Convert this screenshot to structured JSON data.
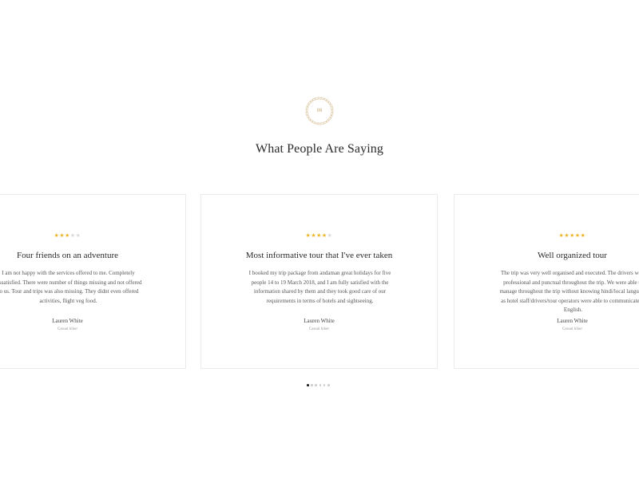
{
  "section": {
    "badge_number": "06",
    "title": "What People Are Saying"
  },
  "colors": {
    "star_filled": "#f0b429",
    "star_empty": "#d9d9d9",
    "badge": "#d8c39a",
    "dot_active": "#222222",
    "dot_inactive": "#cfcfcf"
  },
  "testimonials": [
    {
      "rating": 3,
      "max_rating": 5,
      "title": "Four friends on an adventure",
      "body": "I am not happy with the services offered to me. Completely dissatisfied. There were number of things missing and not offered to us. Tour and trips was also missing. They didnt even offered activities, flight veg food.",
      "author": "Lauren White",
      "role": "Casual hiker"
    },
    {
      "rating": 4,
      "max_rating": 5,
      "title": "Most informative tour that I've ever taken",
      "body": "I booked my trip package from andaman great holidays for five people 14 to 19 March 2018, and I am fully satisfied with the information shared by them and they took good care of our requirements in terms of hotels and sightseeing.",
      "author": "Lauren White",
      "role": "Casual hiker"
    },
    {
      "rating": 5,
      "max_rating": 5,
      "title": "Well organized tour",
      "body": "The trip was very well organised and executed. The drivers were professional and punctual throughout the trip. We were able to manage throughout the trip without knowing hindi/local language as hotel staff/drivers/tour operators were able to communicate in English.",
      "author": "Lauren White",
      "role": "Casual hiker"
    }
  ],
  "pagination": {
    "count": 6,
    "active_index": 0
  }
}
